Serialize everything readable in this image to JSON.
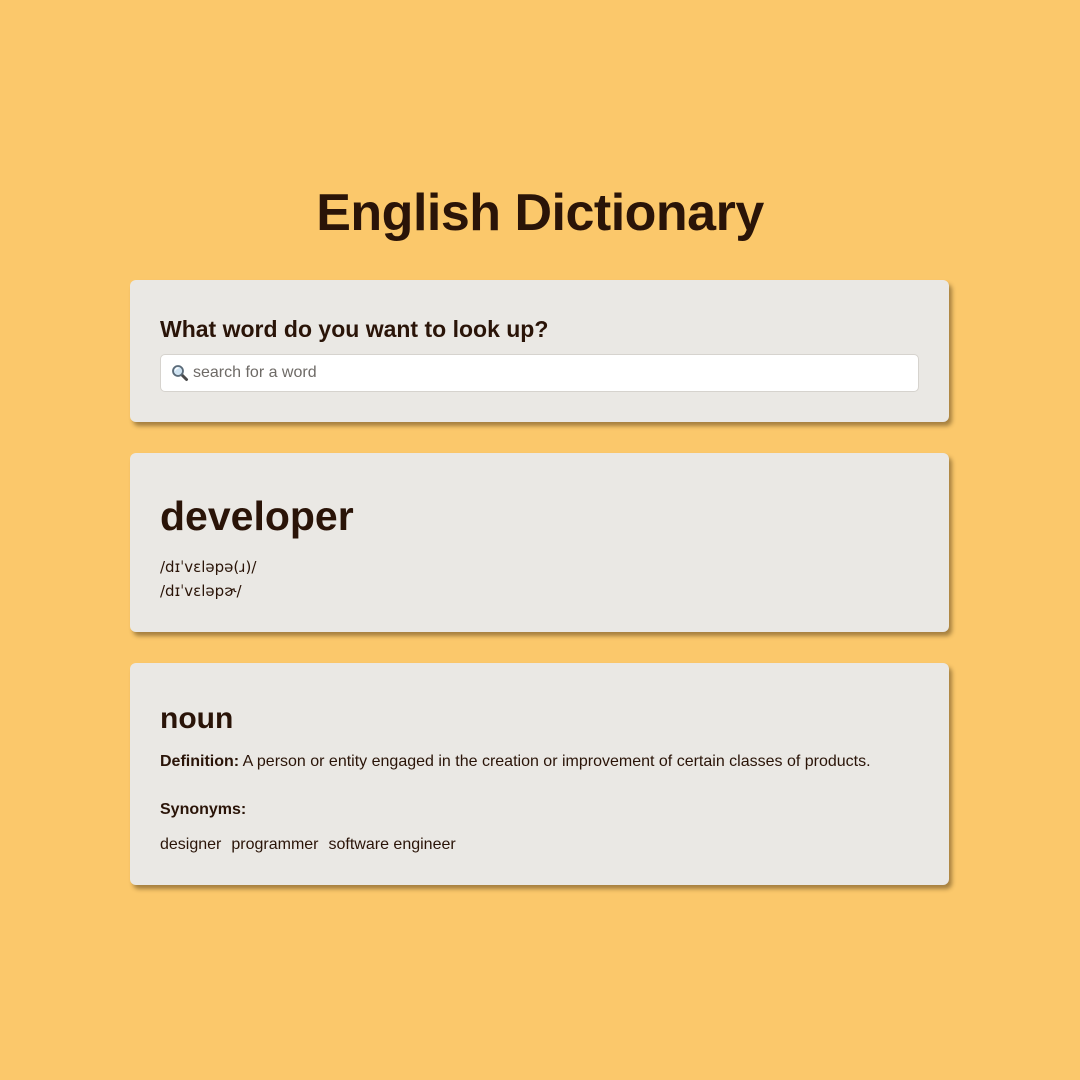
{
  "app": {
    "title": "English Dictionary"
  },
  "search": {
    "prompt": "What word do you want to look up?",
    "placeholder": "search for a word",
    "value": "",
    "icon": "magnifying-glass-icon"
  },
  "entry": {
    "word": "developer",
    "phonetics": [
      "/dɪˈvɛləpə(ɹ)/",
      "/dɪˈvɛləpɚ/"
    ]
  },
  "meaning": {
    "part_of_speech": "noun",
    "definition_label": "Definition:",
    "definition": "A person or entity engaged in the creation or improvement of certain classes of products.",
    "synonyms_label": "Synonyms:",
    "synonyms": [
      "designer",
      "programmer",
      "software engineer"
    ]
  },
  "colors": {
    "background": "#FBC86B",
    "card": "#EAE8E4",
    "text": "#2A1408"
  }
}
